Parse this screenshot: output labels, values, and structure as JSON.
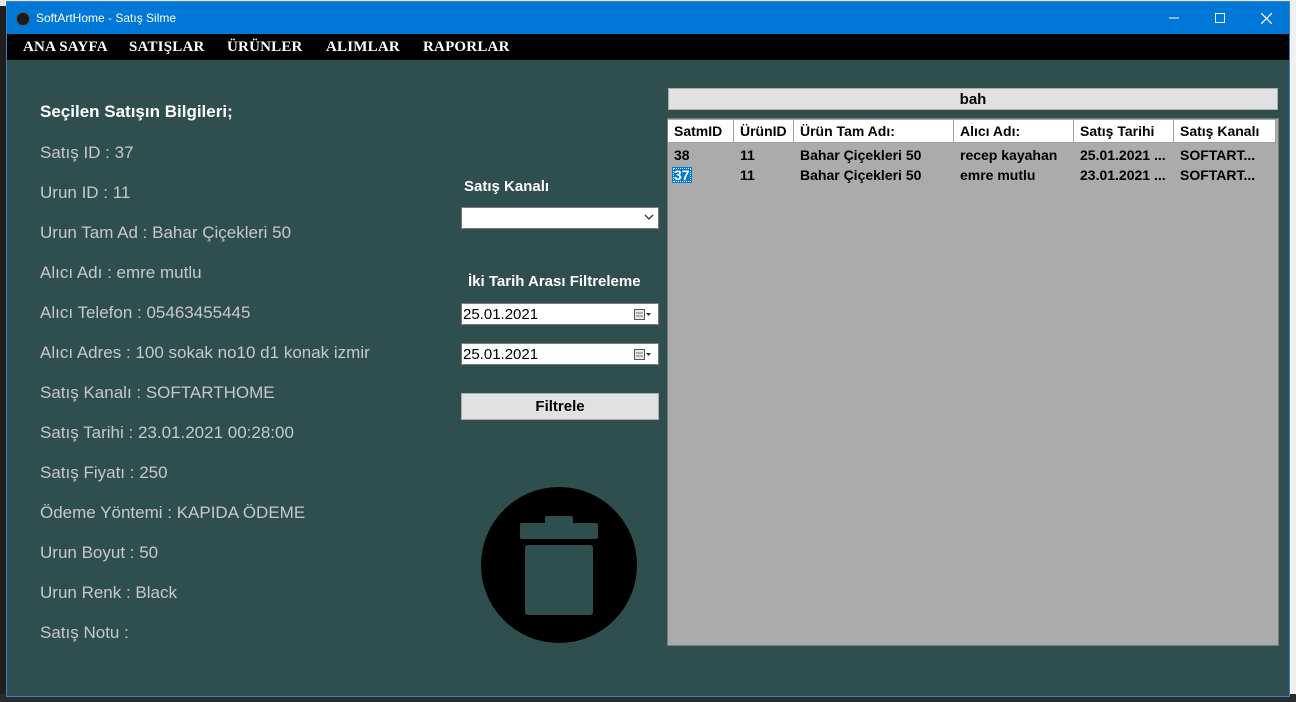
{
  "window": {
    "title": "SoftArtHome - Satış Silme"
  },
  "menu": [
    "ANA SAYFA",
    "SATIŞLAR",
    "ÜRÜNLER",
    "ALIMLAR",
    "RAPORLAR"
  ],
  "info": {
    "header": "Seçilen Satışın Bilgileri;",
    "lines": [
      "Satış ID : 37",
      "Urun ID : 11",
      "Urun Tam Ad : Bahar Çiçekleri 50",
      "Alıcı Adı : emre mutlu",
      "Alıcı Telefon : 05463455445",
      "Alıcı Adres  : 100 sokak no10 d1 konak izmir",
      "Satış Kanalı : SOFTARTHOME",
      "Satış Tarihi : 23.01.2021 00:28:00",
      "Satış Fiyatı : 250",
      "Ödeme Yöntemi : KAPIDA ÖDEME",
      "Urun Boyut : 50",
      "Urun Renk : Black",
      "Satış Notu :"
    ]
  },
  "filter": {
    "channel_label": "Satış Kanalı",
    "channel_value": "",
    "date_label": "İki Tarih Arası Filtreleme",
    "date_from": "25.01.2021",
    "date_to": "25.01.2021",
    "button": "Filtrele"
  },
  "grid": {
    "top_button": "bah",
    "columns": [
      "SatmID",
      "ÜrünID",
      "Ürün Tam Adı:",
      "Alıcı Adı:",
      "Satış Tarihi",
      "Satış Kanalı"
    ],
    "rows": [
      [
        "38",
        "11",
        "Bahar Çiçekleri 50",
        "recep kayahan",
        "25.01.2021 ...",
        "SOFTART..."
      ],
      [
        "37",
        "11",
        "Bahar Çiçekleri 50",
        "emre mutlu",
        "23.01.2021 ...",
        "SOFTART..."
      ]
    ],
    "selected_row": 1
  },
  "colors": {
    "titlebar": "#0078d7",
    "window_bg": "#2f4f4f",
    "menubar": "#000000",
    "grid_bg": "#ababab"
  },
  "icons": [
    "app-icon",
    "minimize-icon",
    "maximize-icon",
    "close-icon",
    "dropdown-arrow-icon",
    "calendar-icon",
    "trash-icon"
  ]
}
